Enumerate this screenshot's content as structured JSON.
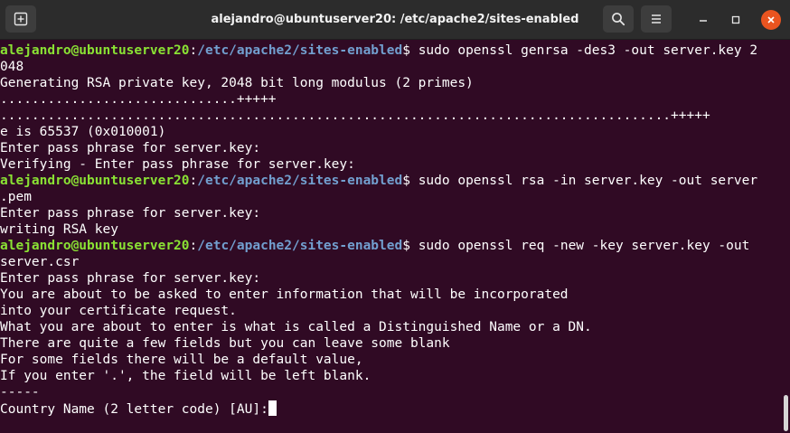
{
  "window": {
    "title": "alejandro@ubuntuserver20: /etc/apache2/sites-enabled"
  },
  "icons": {
    "new_tab": "new-tab-icon",
    "search": "search-icon",
    "menu": "hamburger-menu-icon",
    "minimize": "minimize-icon",
    "maximize": "maximize-icon",
    "close": "close-icon"
  },
  "colors": {
    "terminal_background": "#300a24",
    "prompt_user": "#8ae234",
    "prompt_path": "#729fcf",
    "text": "#ffffff",
    "close_button": "#e95420"
  },
  "terminal": {
    "prompt_user_host": "alejandro@ubuntuserver20",
    "prompt_separator": ":",
    "prompt_path": "/etc/apache2/sites-enabled",
    "prompt_symbol": "$",
    "cmd1": " sudo openssl genrsa -des3 -out server.key 2",
    "cmd1_wrap": "048",
    "out1": [
      "Generating RSA private key, 2048 bit long modulus (2 primes)",
      "..............................+++++",
      ".....................................................................................+++++",
      "e is 65537 (0x010001)",
      "Enter pass phrase for server.key:",
      "Verifying - Enter pass phrase for server.key:"
    ],
    "cmd2": " sudo openssl rsa -in server.key -out server",
    "cmd2_wrap": ".pem",
    "out2": [
      "Enter pass phrase for server.key:",
      "writing RSA key"
    ],
    "cmd3": " sudo openssl req -new -key server.key -out",
    "cmd3_wrap": "server.csr",
    "out3": [
      "Enter pass phrase for server.key:",
      "You are about to be asked to enter information that will be incorporated",
      "into your certificate request.",
      "What you are about to enter is what is called a Distinguished Name or a DN.",
      "There are quite a few fields but you can leave some blank",
      "For some fields there will be a default value,",
      "If you enter '.', the field will be left blank.",
      "-----"
    ],
    "current_input": "Country Name (2 letter code) [AU]:"
  }
}
